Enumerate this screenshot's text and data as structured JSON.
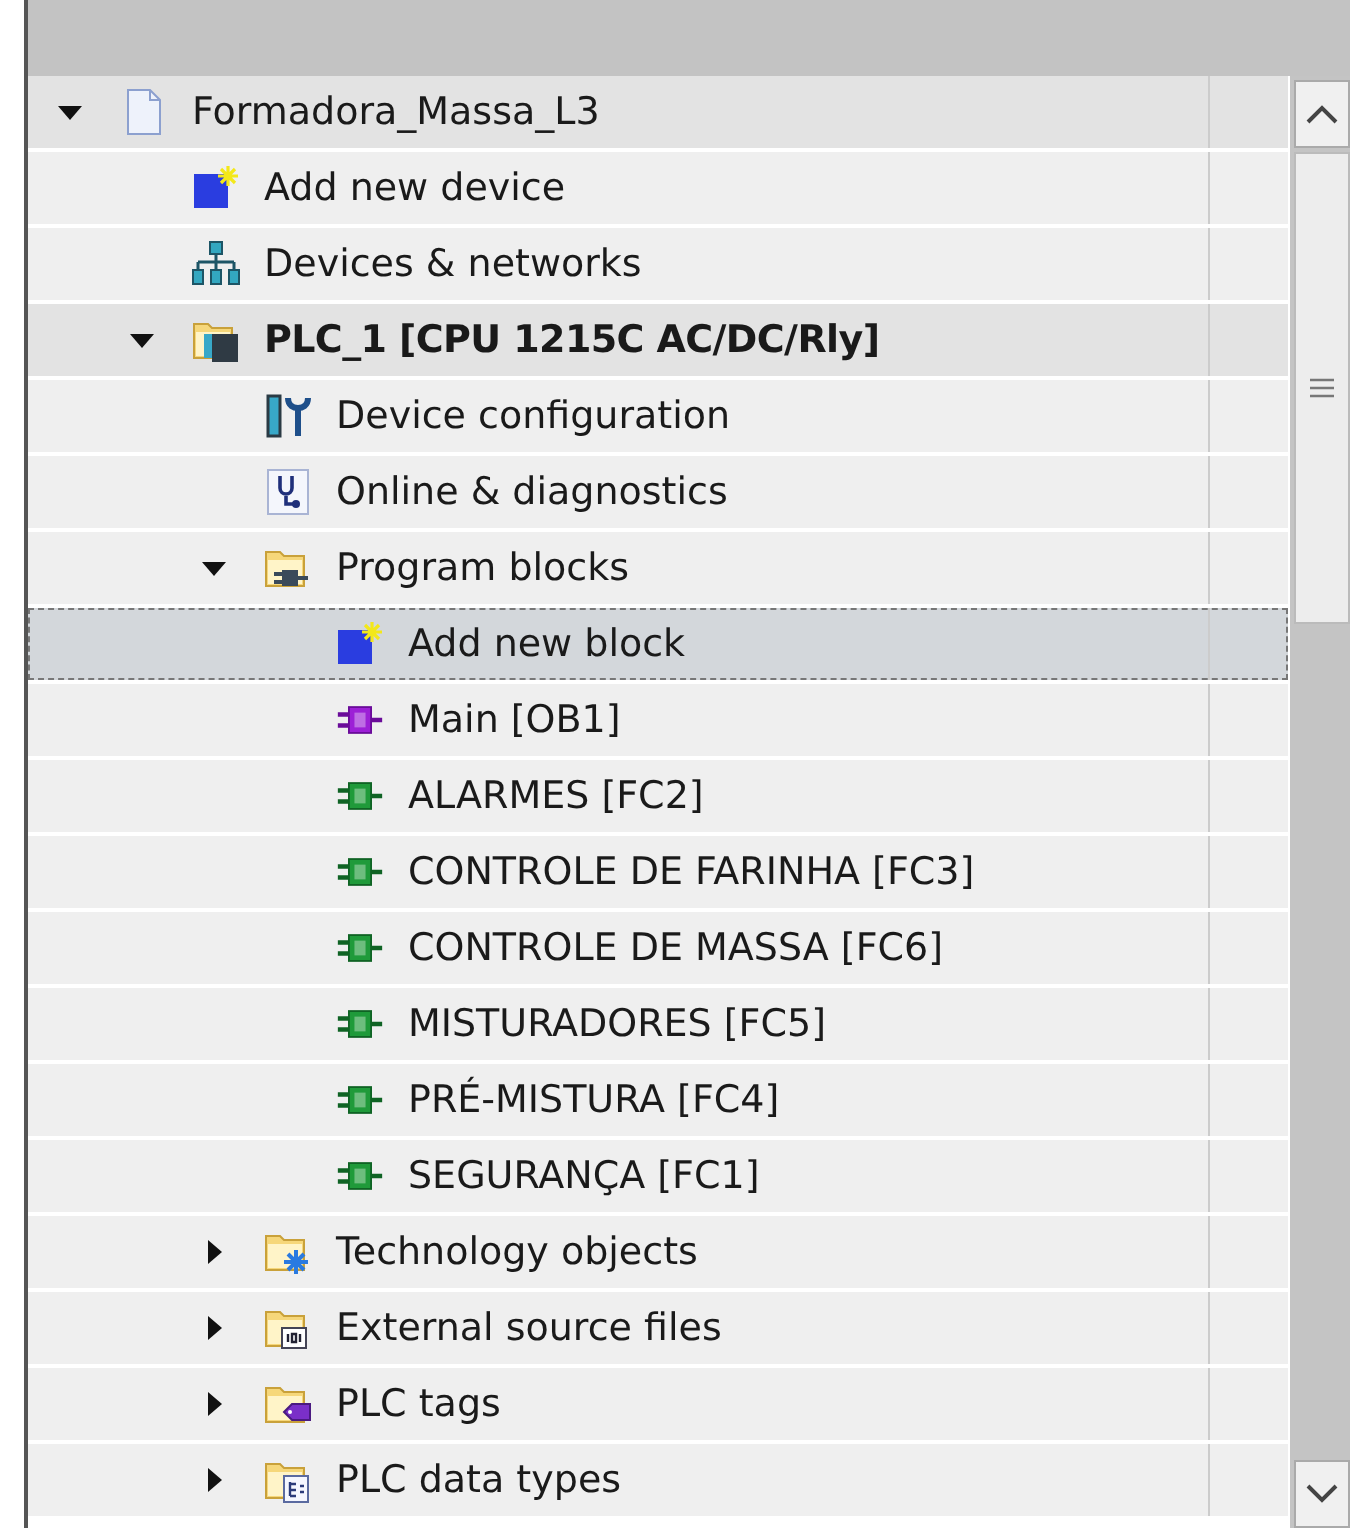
{
  "project_tree": [
    {
      "label": "Formadora_Massa_L3",
      "kind": "project",
      "expanded": true,
      "selected": false,
      "children": [
        {
          "label": "Add new device",
          "kind": "add-device",
          "selected": false
        },
        {
          "label": "Devices & networks",
          "kind": "network",
          "selected": false
        },
        {
          "label": "PLC_1 [CPU 1215C AC/DC/Rly]",
          "kind": "plc",
          "expanded": true,
          "selected": false,
          "children": [
            {
              "label": "Device configuration",
              "kind": "device-config",
              "selected": false
            },
            {
              "label": "Online & diagnostics",
              "kind": "diagnostics",
              "selected": false
            },
            {
              "label": "Program blocks",
              "kind": "folder-blocks",
              "expanded": true,
              "selected": false,
              "children": [
                {
                  "label": "Add new block",
                  "kind": "add-block",
                  "selected": true
                },
                {
                  "label": "Main [OB1]",
                  "kind": "ob",
                  "selected": false
                },
                {
                  "label": "ALARMES [FC2]",
                  "kind": "fc",
                  "selected": false
                },
                {
                  "label": "CONTROLE DE FARINHA [FC3]",
                  "kind": "fc",
                  "selected": false
                },
                {
                  "label": "CONTROLE DE MASSA [FC6]",
                  "kind": "fc",
                  "selected": false
                },
                {
                  "label": "MISTURADORES [FC5]",
                  "kind": "fc",
                  "selected": false
                },
                {
                  "label": "PRÉ-MISTURA [FC4]",
                  "kind": "fc",
                  "selected": false
                },
                {
                  "label": "SEGURANÇA [FC1]",
                  "kind": "fc",
                  "selected": false
                }
              ]
            },
            {
              "label": "Technology objects",
              "kind": "folder-tech",
              "expanded": false,
              "selected": false
            },
            {
              "label": "External source files",
              "kind": "folder-source",
              "expanded": false,
              "selected": false
            },
            {
              "label": "PLC tags",
              "kind": "folder-tags",
              "expanded": false,
              "selected": false
            },
            {
              "label": "PLC data types",
              "kind": "folder-types",
              "expanded": false,
              "selected": false
            }
          ]
        }
      ]
    }
  ]
}
